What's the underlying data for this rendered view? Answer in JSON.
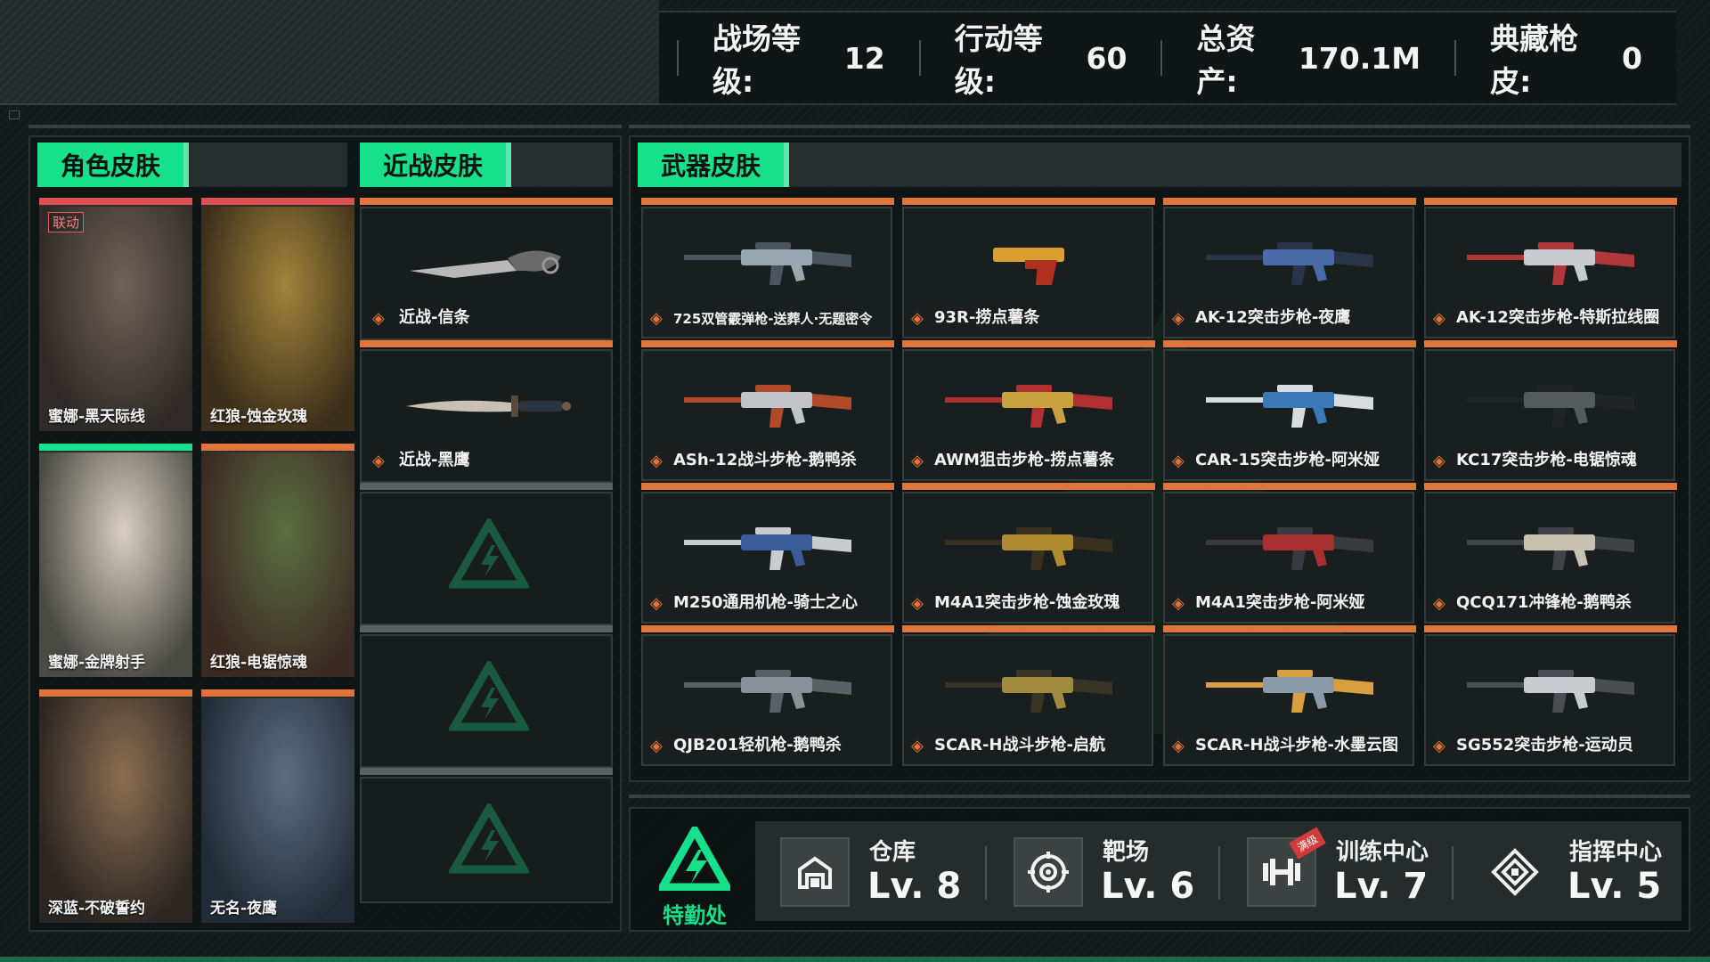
{
  "stats": [
    {
      "label": "战场等级:",
      "value": "12"
    },
    {
      "label": "行动等级:",
      "value": "60"
    },
    {
      "label": "总资产:",
      "value": "170.1M"
    },
    {
      "label": "典藏枪皮:",
      "value": "0"
    }
  ],
  "sections": {
    "character": "角色皮肤",
    "melee": "近战皮肤",
    "weapon": "武器皮肤"
  },
  "characters": [
    {
      "name": "蜜娜-黑天际线",
      "badge": "联动",
      "accent": "#e05050"
    },
    {
      "name": "红狼-蚀金玫瑰",
      "badge": "",
      "accent": "#e05050"
    },
    {
      "name": "蜜娜-金牌射手",
      "badge": "",
      "accent": "#16e08a"
    },
    {
      "name": "红狼-电锯惊魂",
      "badge": "",
      "accent": "#e0743a"
    },
    {
      "name": "深蓝-不破誓约",
      "badge": "",
      "accent": "#e0743a"
    },
    {
      "name": "无名-夜鹰",
      "badge": "",
      "accent": "#e0743a"
    }
  ],
  "melee": [
    {
      "name": "近战-信条"
    },
    {
      "name": "近战-黑鹰"
    },
    {
      "name": ""
    },
    {
      "name": ""
    },
    {
      "name": ""
    }
  ],
  "weapons": [
    {
      "name": "725双管霰弹枪-送葬人·无题密令"
    },
    {
      "name": "93R-捞点薯条"
    },
    {
      "name": "AK-12突击步枪-夜鹰"
    },
    {
      "name": "AK-12突击步枪-特斯拉线圈"
    },
    {
      "name": "ASh-12战斗步枪-鹅鸭杀"
    },
    {
      "name": "AWM狙击步枪-捞点薯条"
    },
    {
      "name": "CAR-15突击步枪-阿米娅"
    },
    {
      "name": "KC17突击步枪-电锯惊魂"
    },
    {
      "name": "M250通用机枪-骑士之心"
    },
    {
      "name": "M4A1突击步枪-蚀金玫瑰"
    },
    {
      "name": "M4A1突击步枪-阿米娅"
    },
    {
      "name": "QCQ171冲锋枪-鹅鸭杀"
    },
    {
      "name": "QJB201轻机枪-鹅鸭杀"
    },
    {
      "name": "SCAR-H战斗步枪-启航"
    },
    {
      "name": "SCAR-H战斗步枪-水墨云图"
    },
    {
      "name": "SG552突击步枪-运动员"
    }
  ],
  "hq_label": "特勤处",
  "facilities": [
    {
      "name": "仓库",
      "level": "Lv. 8",
      "icon": "warehouse-icon",
      "badge": ""
    },
    {
      "name": "靶场",
      "level": "Lv. 6",
      "icon": "target-icon",
      "badge": ""
    },
    {
      "name": "训练中心",
      "level": "Lv. 7",
      "icon": "dumbbell-icon",
      "badge": "满级"
    },
    {
      "name": "指挥中心",
      "level": "Lv. 5",
      "icon": "command-icon",
      "badge": ""
    }
  ],
  "colors": {
    "accent_green": "#16e08a",
    "accent_orange": "#e0743a",
    "accent_red": "#e05050"
  }
}
